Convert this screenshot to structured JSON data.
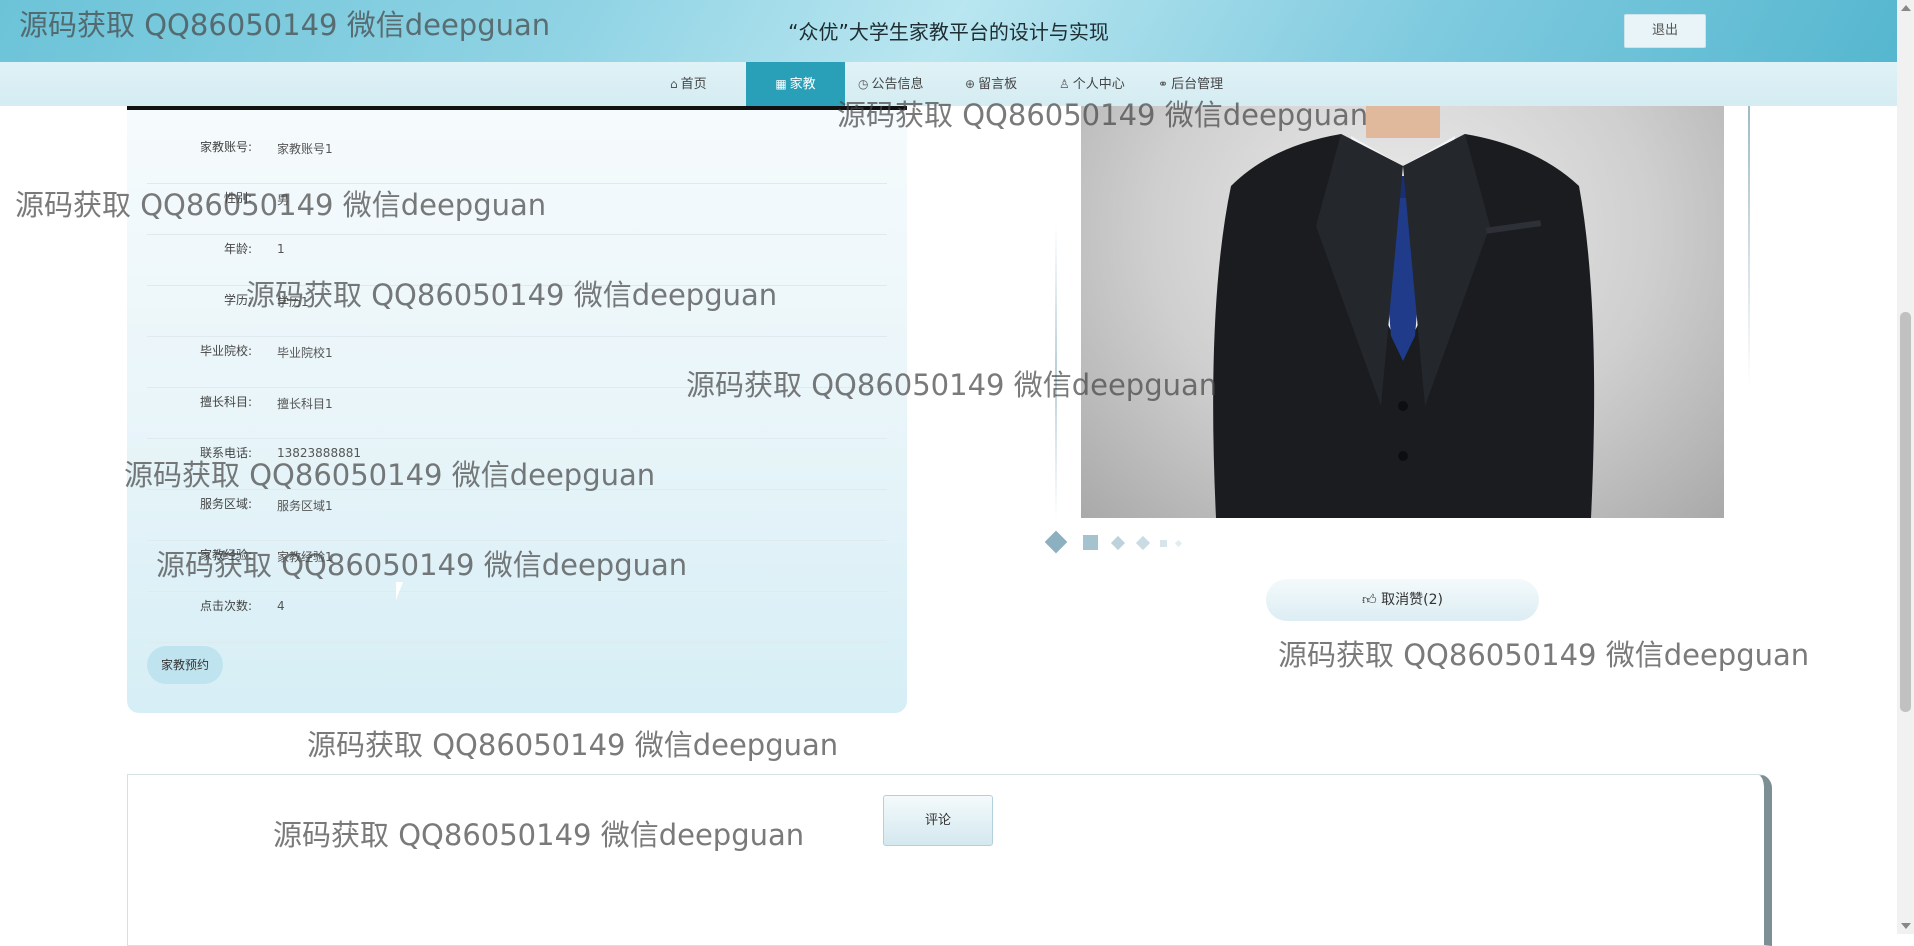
{
  "header": {
    "title": "“众优”大学生家教平台的设计与实现",
    "logout_label": "退出"
  },
  "nav": [
    {
      "label": "首页",
      "icon": "home-icon",
      "glyph": "⌂"
    },
    {
      "label": "家教",
      "icon": "grid-icon",
      "glyph": "▦",
      "active": true
    },
    {
      "label": "公告信息",
      "icon": "clock-icon",
      "glyph": "◷"
    },
    {
      "label": "留言板",
      "icon": "globe-icon",
      "glyph": "⊕"
    },
    {
      "label": "个人中心",
      "icon": "user-icon",
      "glyph": "♙"
    },
    {
      "label": "后台管理",
      "icon": "link-icon",
      "glyph": "⚭"
    }
  ],
  "detail": {
    "fields": [
      {
        "label": "家教账号:",
        "value": "家教账号1"
      },
      {
        "label": "性别:",
        "value": "男"
      },
      {
        "label": "年龄:",
        "value": "1"
      },
      {
        "label": "学历:",
        "value": "学历1"
      },
      {
        "label": "毕业院校:",
        "value": "毕业院校1"
      },
      {
        "label": "擅长科目:",
        "value": "擅长科目1"
      },
      {
        "label": "联系电话:",
        "value": "13823888881"
      },
      {
        "label": "服务区域:",
        "value": "服务区域1"
      },
      {
        "label": "家教经验:",
        "value": "家教经验1"
      },
      {
        "label": "点击次数:",
        "value": "4"
      }
    ],
    "book_label": "家教预约"
  },
  "photo": {
    "alt": "家教照片"
  },
  "carousel": {
    "count": 6,
    "active": 0
  },
  "like": {
    "label": "取消赞(2)",
    "icon": "thumbs-up-icon"
  },
  "comment": {
    "button_label": "评论"
  },
  "watermark": "源码获取 QQ86050149 微信deepguan",
  "colors": {
    "accent": "#2aa0b8",
    "header": "#7fcadf"
  }
}
